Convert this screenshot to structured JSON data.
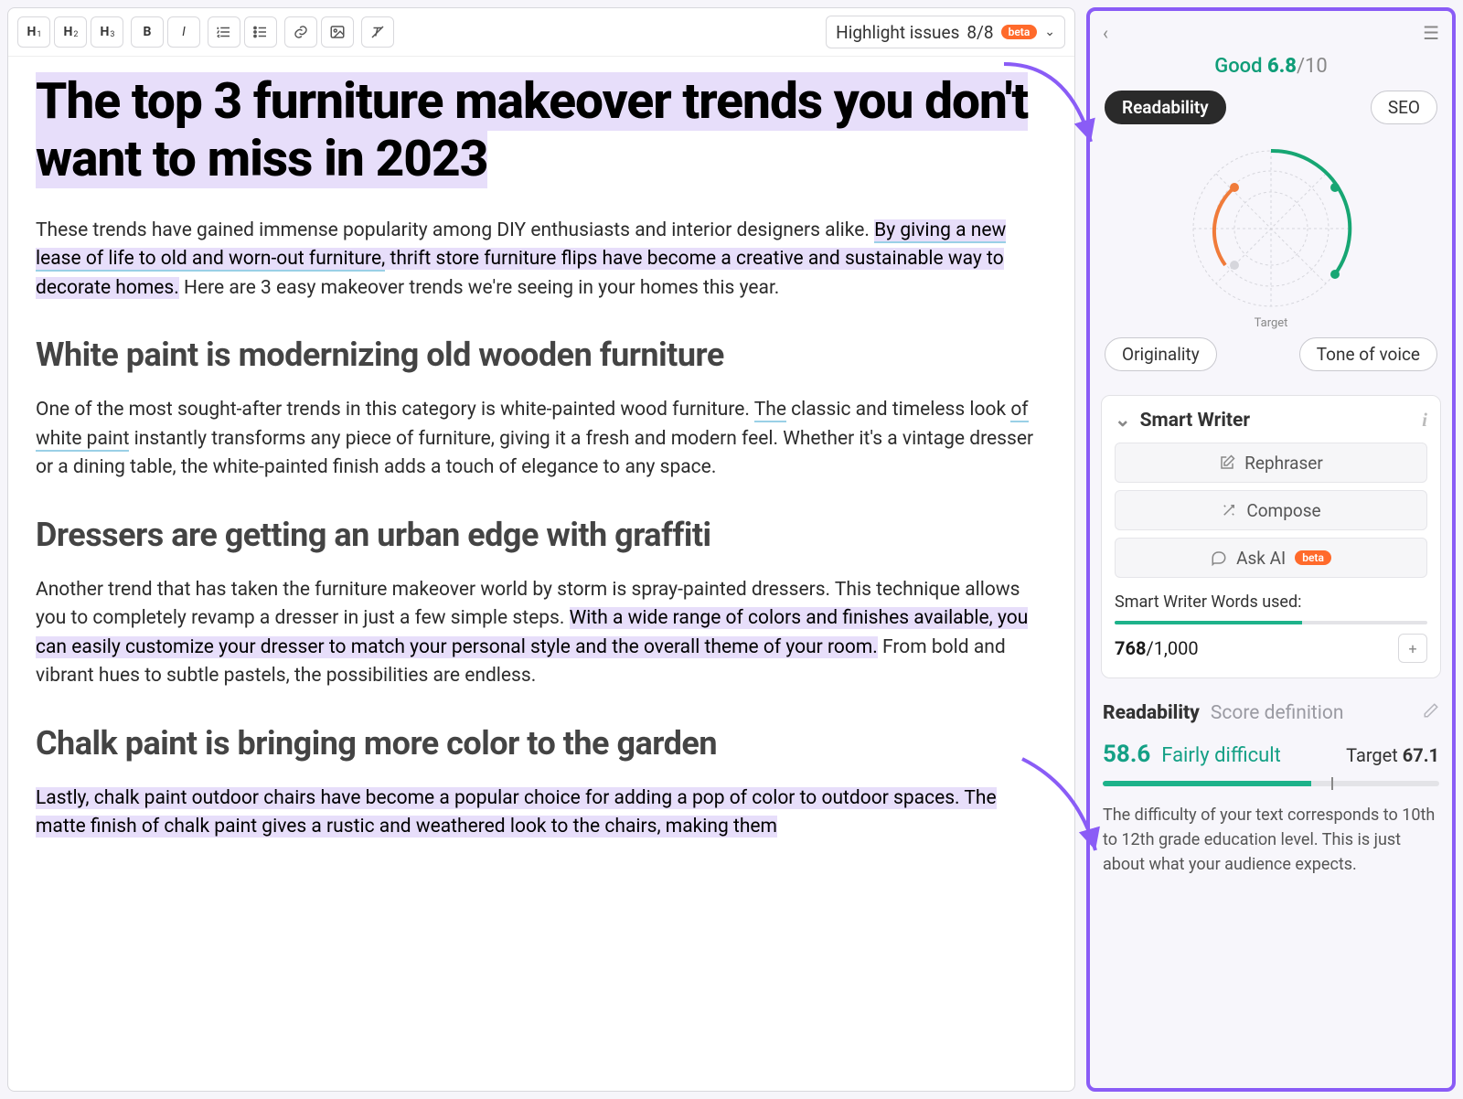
{
  "toolbar": {
    "h1": "H",
    "h1s": "1",
    "h2": "H",
    "h2s": "2",
    "h3": "H",
    "h3s": "3",
    "bold": "B",
    "italic": "I",
    "highlight_label": "Highlight issues",
    "highlight_count": "8/8",
    "beta": "beta"
  },
  "article": {
    "title": "The top 3 furniture makeover trends you don't want to miss in 2023",
    "p1a": "These trends have gained immense popularity among DIY enthusiasts and interior designers alike. ",
    "p1b": "By giving a new lease of life to old and worn-out furniture,",
    "p1c": " thrift store furniture flips have become a creative and sustainable way to decorate homes.",
    "p1d": " Here are 3 easy makeover trends we're seeing in your homes this year.",
    "h2a": "White paint is modernizing old wooden furniture",
    "p2a": "One of the most sought-after trends in this category is white-painted wood furniture. ",
    "p2b": "The",
    "p2c": " classic and timeless look ",
    "p2d": "of white paint",
    "p2e": " instantly transforms any piece of furniture, giving it a fresh and modern feel. Whether it's a vintage dresser or a dining table, the white-painted finish adds a touch of elegance to any space.",
    "h2b": "Dressers are getting an urban edge with graffiti",
    "p3a": "Another trend that has taken the furniture makeover world by storm is spray-painted dressers. This technique allows you to completely revamp a dresser in just a few simple steps. ",
    "p3b": "With a wide range of colors and finishes available, you can easily customize your dresser to match your personal style and the overall theme of your room.",
    "p3c": " From bold and vibrant hues to subtle pastels, the possibilities are endless.",
    "h2c": "Chalk paint is bringing more color to the garden",
    "p4a": "Lastly, chalk paint outdoor chairs have become a popular choice for adding a pop of color to outdoor spaces. The matte finish of chalk paint gives a rustic and weathered look to the chairs, making them"
  },
  "sidebar": {
    "score_label": "Good",
    "score_value": "6.8",
    "score_denom": "/10",
    "pill_readability": "Readability",
    "pill_seo": "SEO",
    "pill_originality": "Originality",
    "pill_tone": "Tone of voice",
    "radar_target": "Target",
    "smart_title": "Smart Writer",
    "btn_rephraser": "Rephraser",
    "btn_compose": "Compose",
    "btn_askai": "Ask AI",
    "askai_beta": "beta",
    "words_label": "Smart Writer Words used:",
    "words_used": "768",
    "words_total": "/1,000",
    "read_label": "Readability",
    "read_def": "Score definition",
    "read_score": "58.6",
    "read_diff": "Fairly difficult",
    "read_target_lbl": "Target ",
    "read_target_val": "67.1",
    "read_desc": "The difficulty of your text corresponds to 10th to 12th grade education level. This is just about what your audience expects."
  }
}
